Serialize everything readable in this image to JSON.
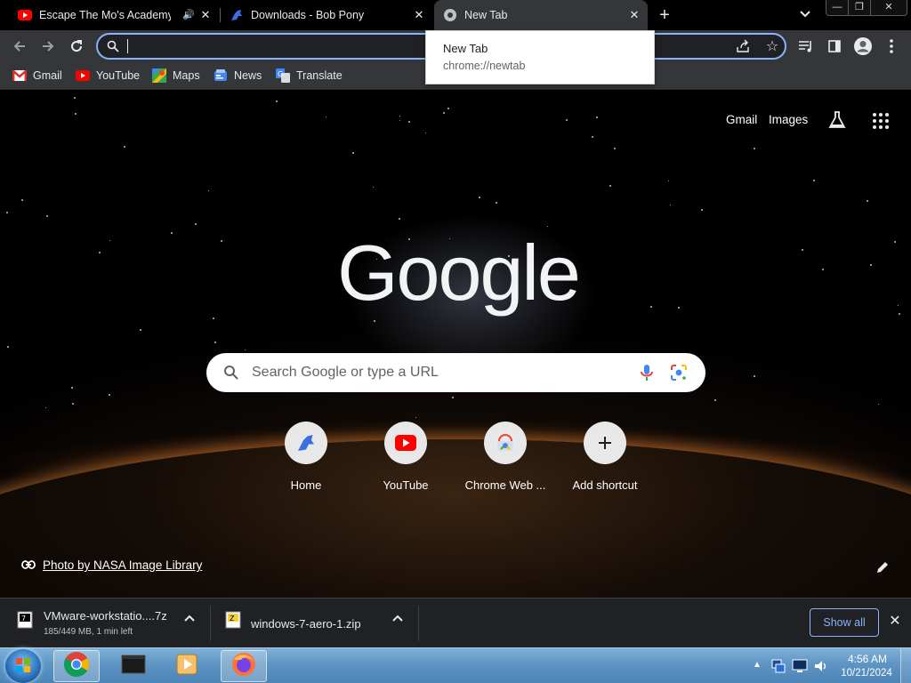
{
  "tabs": [
    {
      "title": "Escape The Mo's Academy - ",
      "icon": "youtube-icon",
      "audio": true
    },
    {
      "title": "Downloads - Bob Pony",
      "icon": "bobpony-icon"
    },
    {
      "title": "New Tab",
      "icon": "chrome-icon",
      "active": true
    }
  ],
  "tooltip": {
    "title": "New Tab",
    "url": "chrome://newtab"
  },
  "omnibox": {
    "value": ""
  },
  "bookmarks": [
    {
      "label": "Gmail",
      "icon": "gmail-icon"
    },
    {
      "label": "YouTube",
      "icon": "youtube-icon"
    },
    {
      "label": "Maps",
      "icon": "maps-icon"
    },
    {
      "label": "News",
      "icon": "news-icon"
    },
    {
      "label": "Translate",
      "icon": "translate-icon"
    }
  ],
  "ntp": {
    "gmail_link": "Gmail",
    "images_link": "Images",
    "logo": "Google",
    "search_placeholder": "Search Google or type a URL",
    "shortcuts": [
      {
        "label": "Home",
        "icon": "bobpony-icon"
      },
      {
        "label": "YouTube",
        "icon": "youtube-icon"
      },
      {
        "label": "Chrome Web ...",
        "icon": "chrome-web-store-icon"
      },
      {
        "label": "Add shortcut",
        "icon": "plus-icon"
      }
    ],
    "photo_credit": "Photo by NASA Image Library"
  },
  "downloads": [
    {
      "name": "VMware-workstatio....7z",
      "status": "185/449 MB, 1 min left",
      "icon": "7z-archive-icon"
    },
    {
      "name": "windows-7-aero-1.zip",
      "status": "",
      "icon": "zip-archive-icon"
    }
  ],
  "shelf": {
    "show_all": "Show all"
  },
  "taskbar": {
    "apps": [
      "chrome-icon",
      "terminal-icon",
      "media-player-icon",
      "firefox-icon"
    ],
    "time": "4:56 AM",
    "date": "10/21/2024"
  },
  "colors": {
    "accent": "#8ab4f8",
    "toolbar": "#35363a",
    "tab_strip": "#000000"
  }
}
